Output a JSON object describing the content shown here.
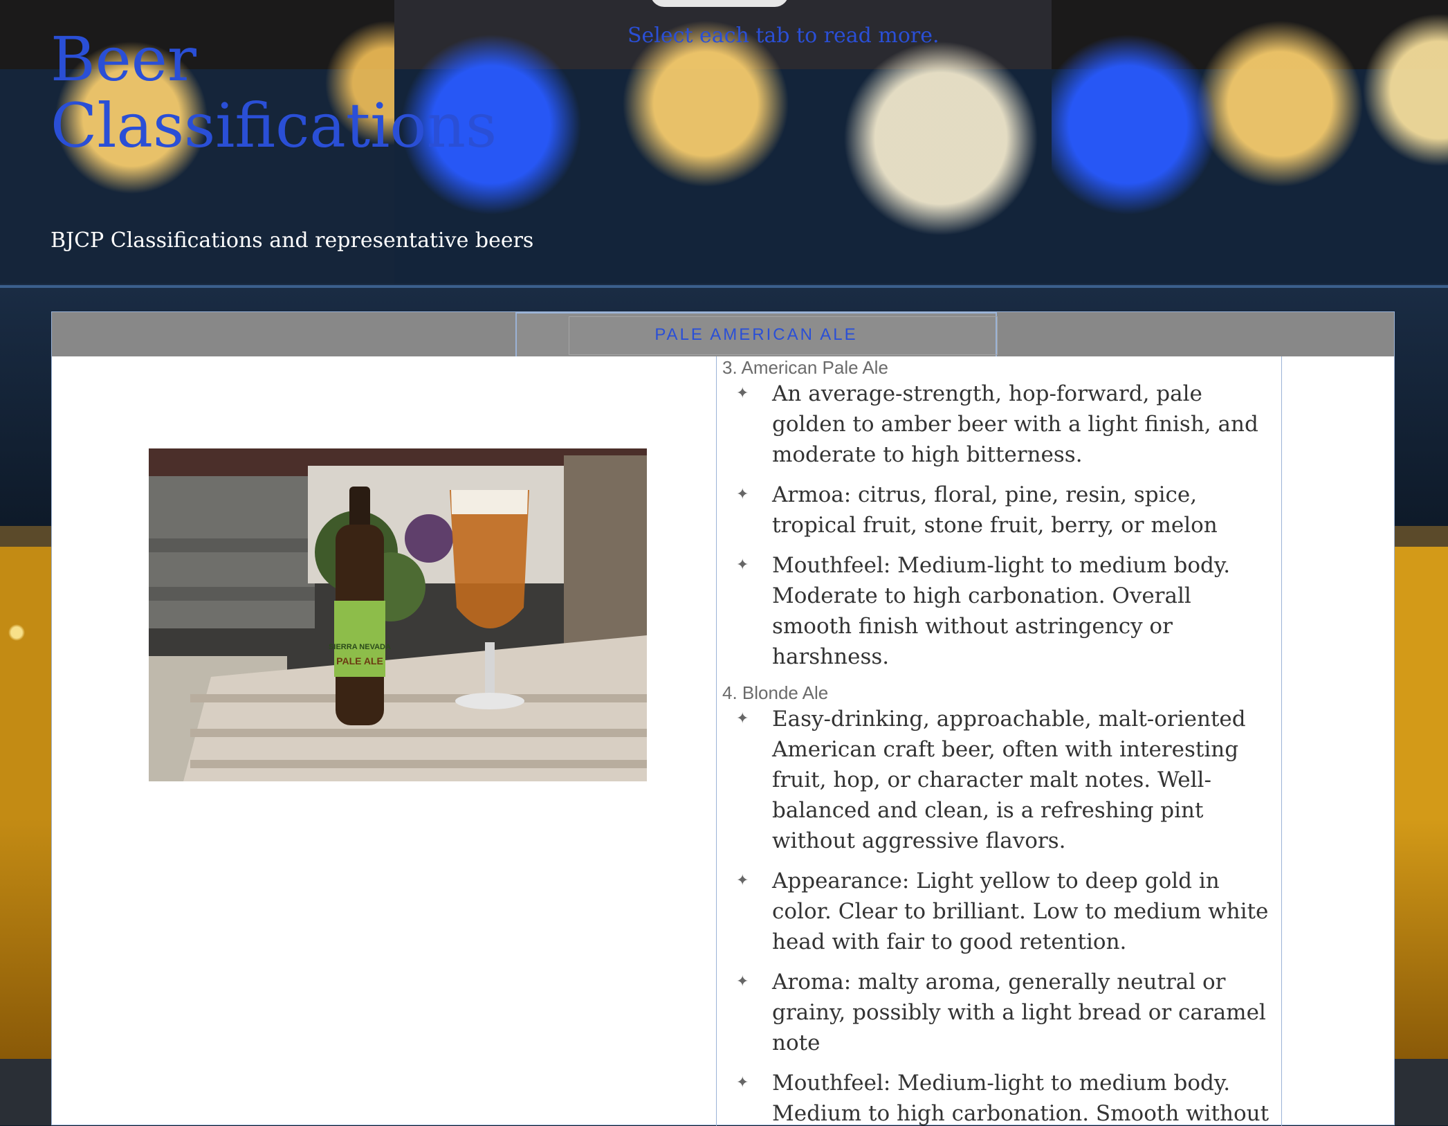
{
  "header": {
    "title": "Beer Classifications",
    "tagline": "Select each tab to read more.",
    "subtitle": "BJCP Classifications and representative beers"
  },
  "tabs": [
    {
      "label": "PALE AMERICAN ALE"
    }
  ],
  "panel": {
    "image": {
      "bottle_label": "SIERRA NEVADA",
      "bottle_style": "PALE ALE"
    },
    "sections": [
      {
        "heading": "3. American Pale Ale",
        "items": [
          "An average-strength, hop-forward, pale golden to amber beer with a light finish, and moderate to high bitterness.",
          "Armoa: citrus, floral, pine, resin, spice, tropical fruit, stone fruit, berry, or melon",
          "Mouthfeel: Medium-light to medium body. Moderate to high carbonation. Overall smooth finish without astringency or harshness."
        ]
      },
      {
        "heading": "4. Blonde Ale",
        "items": [
          "Easy-drinking, approachable, malt-oriented American craft beer, often with interesting fruit, hop, or character malt notes. Well-balanced and clean, is a refreshing pint without aggressive flavors.",
          "Appearance: Light yellow to deep gold in color. Clear to brilliant. Low to medium white head with fair to good retention.",
          "Aroma: malty aroma, generally neutral or grainy, possibly with a light bread or caramel note",
          "Mouthfeel: Medium-light to medium body. Medium to high carbonation. Smooth without being heavy."
        ]
      }
    ]
  },
  "colors": {
    "link_blue": "#2a4fd6",
    "tab_strip": "#888888",
    "panel_border": "#9bb3d6"
  },
  "icons": {
    "bullet": "four-pointed-star-icon"
  }
}
